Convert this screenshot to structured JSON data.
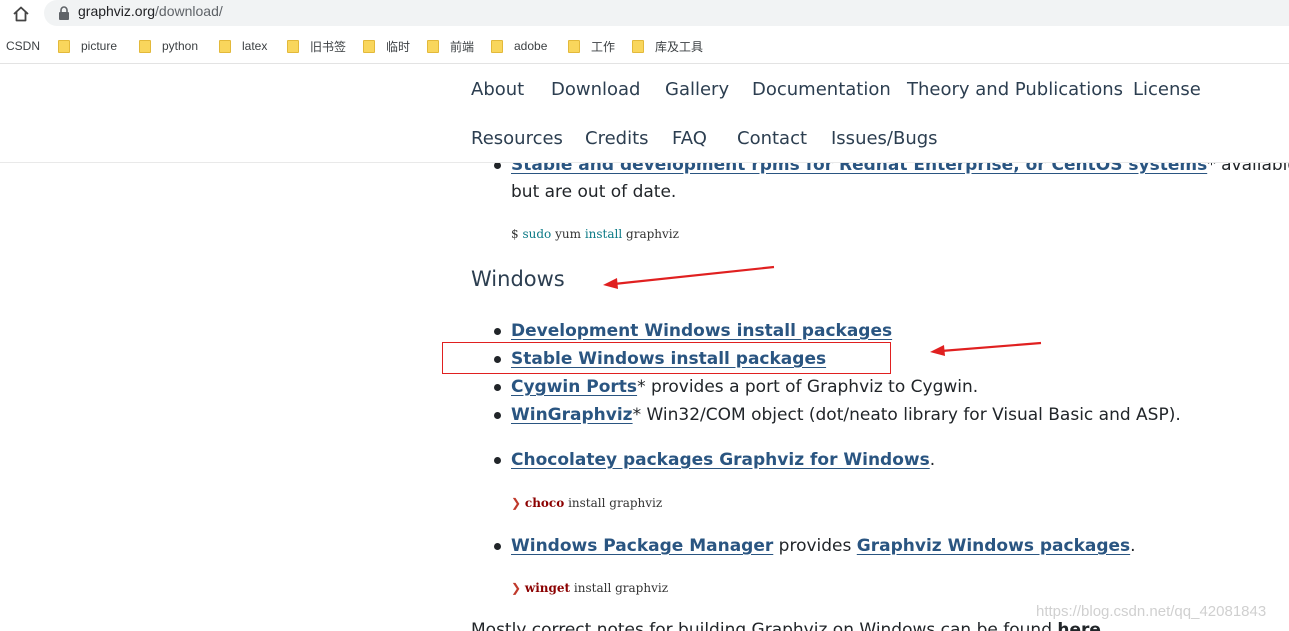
{
  "browser": {
    "url_domain": "graphviz.org",
    "url_path": "/download/",
    "bookmarks": [
      "CSDN",
      "picture",
      "python",
      "latex",
      "旧书签",
      "临时",
      "前端",
      "adobe",
      "工作",
      "库及工具"
    ]
  },
  "nav": {
    "items": [
      "About",
      "Download",
      "Gallery",
      "Documentation",
      "Theory and Publications",
      "License",
      "Resources",
      "Credits",
      "FAQ",
      "Contact",
      "Issues/Bugs"
    ]
  },
  "redhat": {
    "link": "Stable and development rpms for Redhat Enterprise, or CentOS systems",
    "suffix": "* available",
    "line2": "but are out of date.",
    "cmd_prompt": "$",
    "cmd_sudo": "sudo",
    "cmd_yum": "yum",
    "cmd_install": "install",
    "cmd_pkg": "graphviz"
  },
  "windows": {
    "heading": "Windows",
    "items": [
      {
        "link": "Development Windows install packages",
        "text": ""
      },
      {
        "link": "Stable Windows install packages",
        "text": ""
      },
      {
        "link": "Cygwin Ports",
        "text": "* provides a port of Graphviz to Cygwin."
      },
      {
        "link": "WinGraphviz",
        "text": "* Win32/COM object (dot/neato library for Visual Basic and ASP)."
      }
    ],
    "chocolatey": {
      "link": "Chocolatey packages Graphviz for Windows",
      "text": "."
    },
    "choco_cmd": {
      "prompt": "❯",
      "tool": "choco",
      "rest": "install graphviz"
    },
    "winget": {
      "link1": "Windows Package Manager",
      "middle": " provides ",
      "link2": "Graphviz Windows packages",
      "text": "."
    },
    "winget_cmd": {
      "prompt": "❯",
      "tool": "winget",
      "rest": "install graphviz"
    },
    "notes_text": "Mostly correct notes for building Graphviz on Windows can be found ",
    "notes_link": "here"
  },
  "watermark": "https://blog.csdn.net/qq_42081843",
  "annotation_colors": {
    "box": "#e02020",
    "arrow": "#e02020"
  }
}
